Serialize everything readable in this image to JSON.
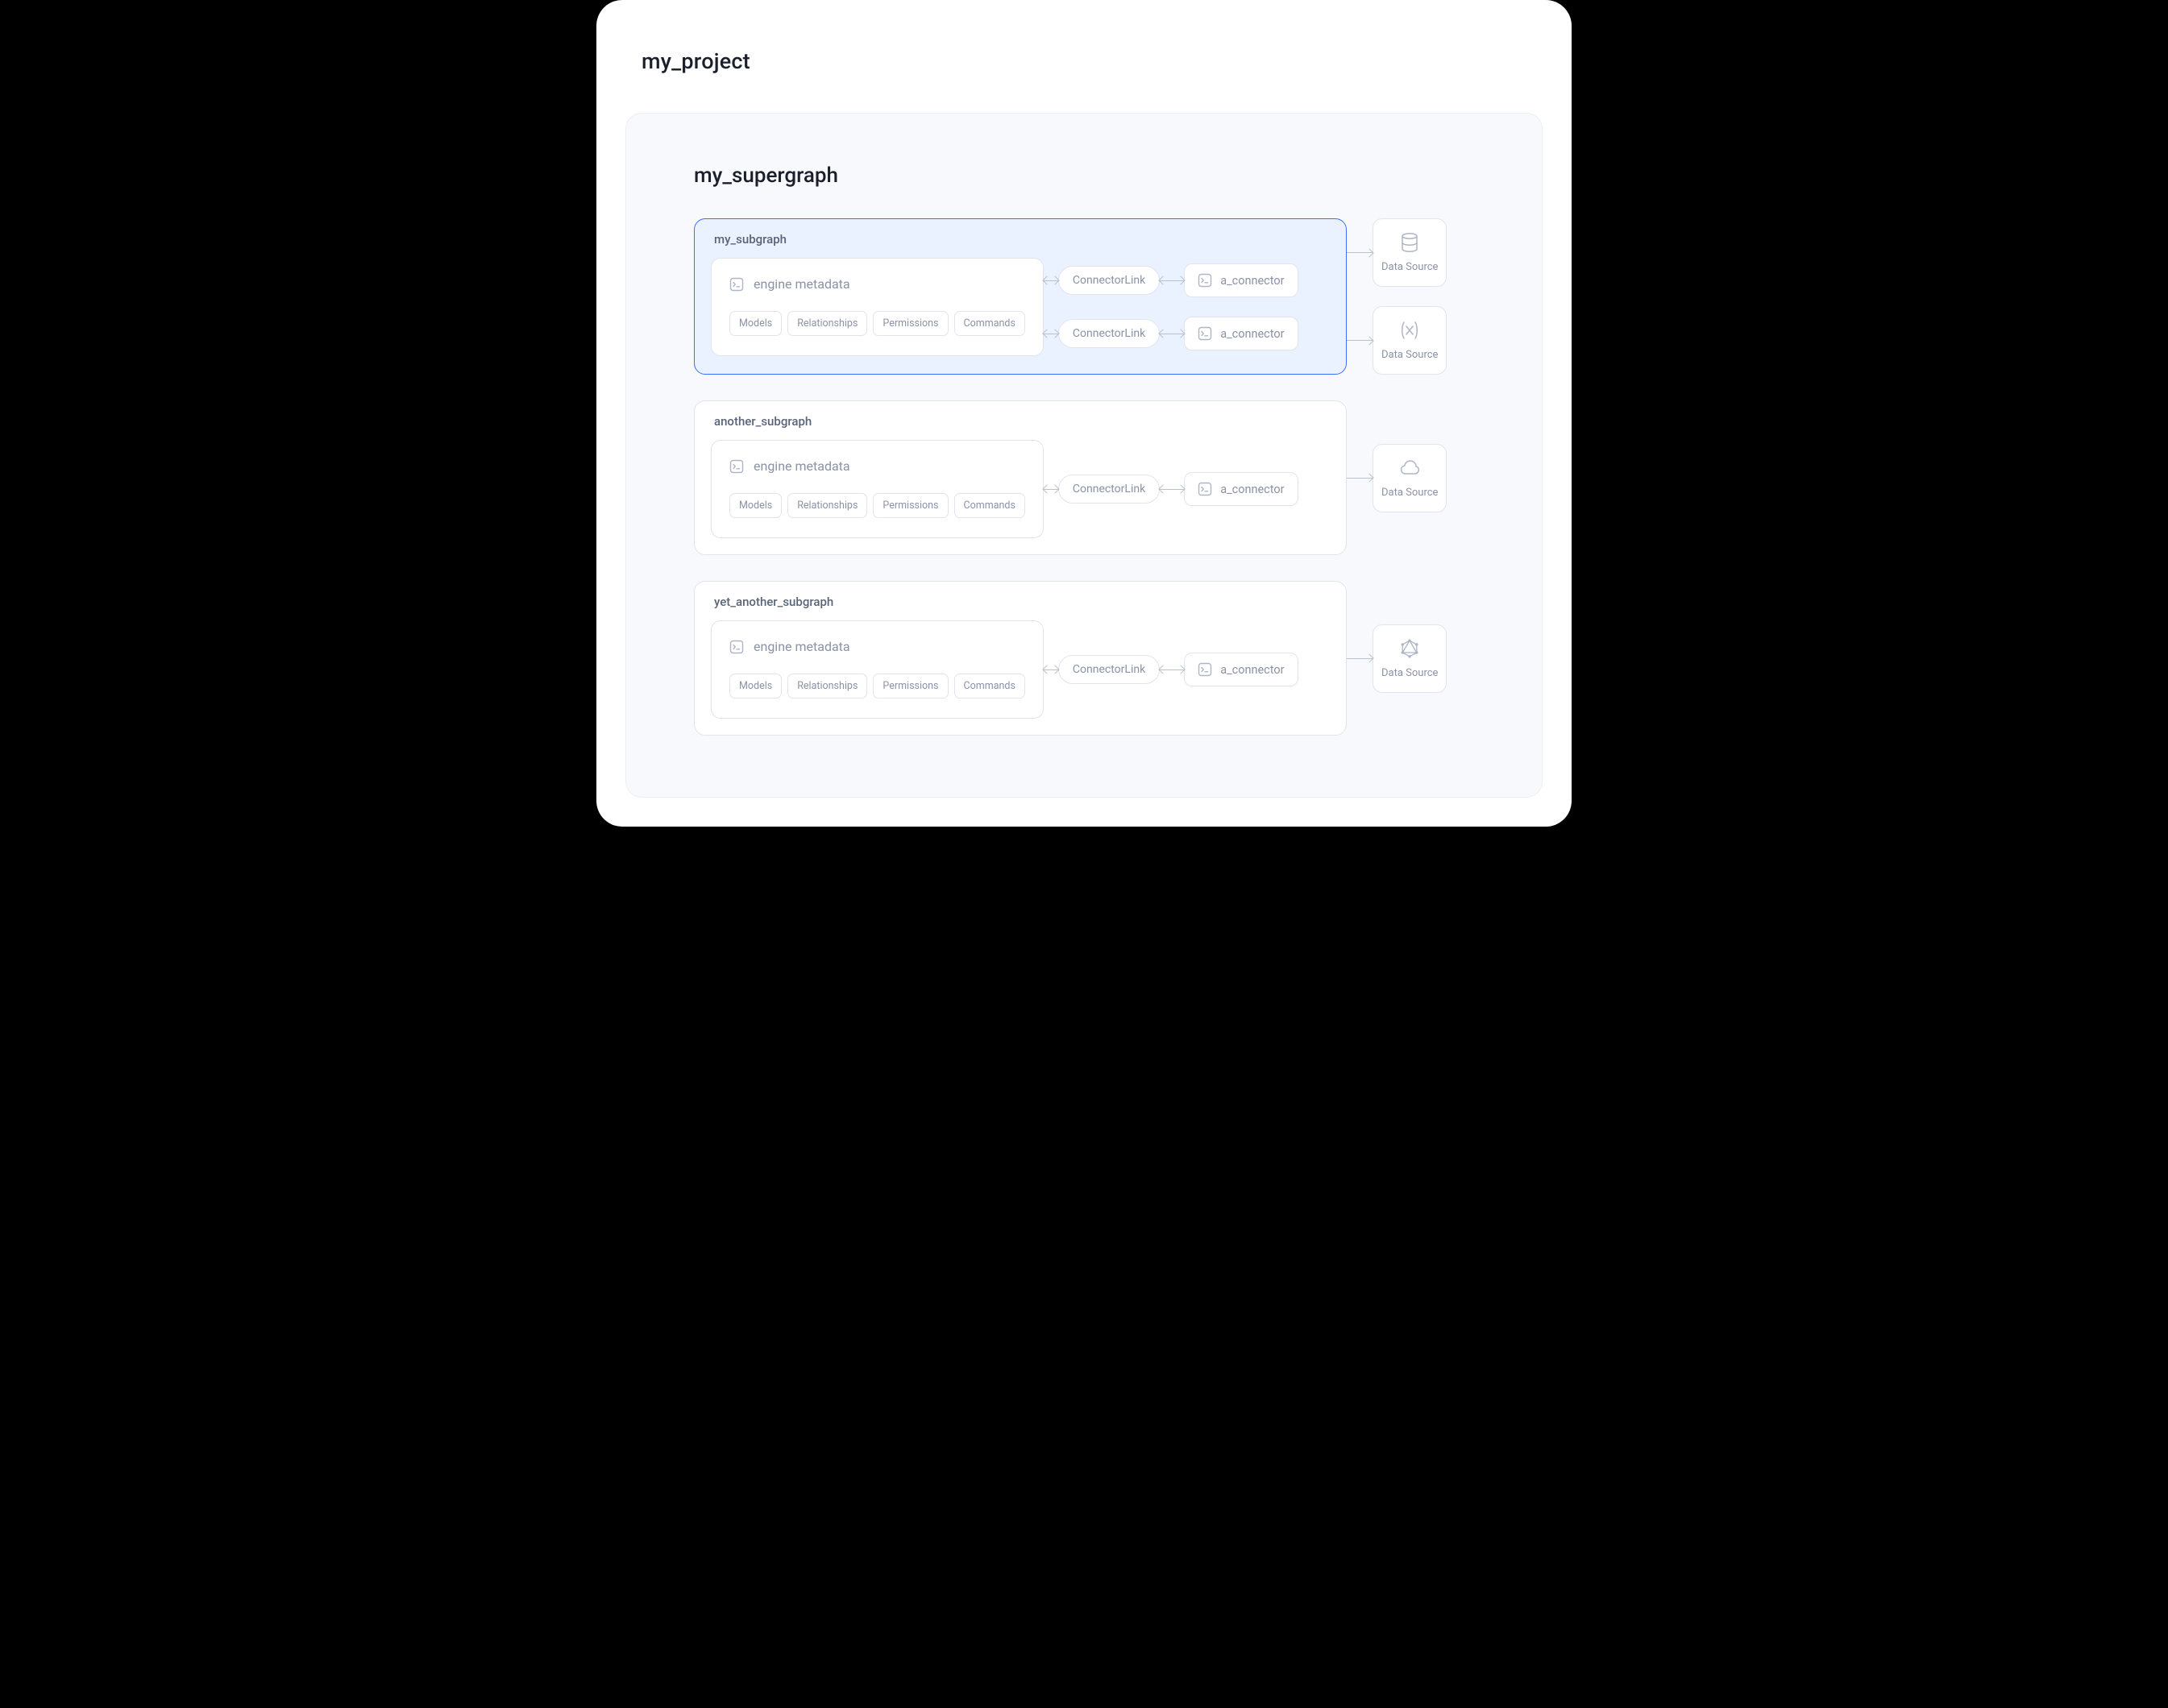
{
  "project": {
    "title": "my_project"
  },
  "supergraph": {
    "title": "my_supergraph",
    "subgraphs": [
      {
        "name": "my_subgraph",
        "highlight": true,
        "metadata": {
          "title": "engine metadata",
          "chips": [
            "Models",
            "Relationships",
            "Permissions",
            "Commands"
          ]
        },
        "flows": [
          {
            "connector_link": "ConnectorLink",
            "connector": "a_connector",
            "datasource": {
              "label": "Data Source",
              "icon": "database"
            }
          },
          {
            "connector_link": "ConnectorLink",
            "connector": "a_connector",
            "datasource": {
              "label": "Data Source",
              "icon": "variable"
            }
          }
        ]
      },
      {
        "name": "another_subgraph",
        "highlight": false,
        "metadata": {
          "title": "engine metadata",
          "chips": [
            "Models",
            "Relationships",
            "Permissions",
            "Commands"
          ]
        },
        "flows": [
          {
            "connector_link": "ConnectorLink",
            "connector": "a_connector",
            "datasource": {
              "label": "Data Source",
              "icon": "cloud"
            }
          }
        ]
      },
      {
        "name": "yet_another_subgraph",
        "highlight": false,
        "metadata": {
          "title": "engine metadata",
          "chips": [
            "Models",
            "Relationships",
            "Permissions",
            "Commands"
          ]
        },
        "flows": [
          {
            "connector_link": "ConnectorLink",
            "connector": "a_connector",
            "datasource": {
              "label": "Data Source",
              "icon": "graphql"
            }
          }
        ]
      }
    ]
  }
}
